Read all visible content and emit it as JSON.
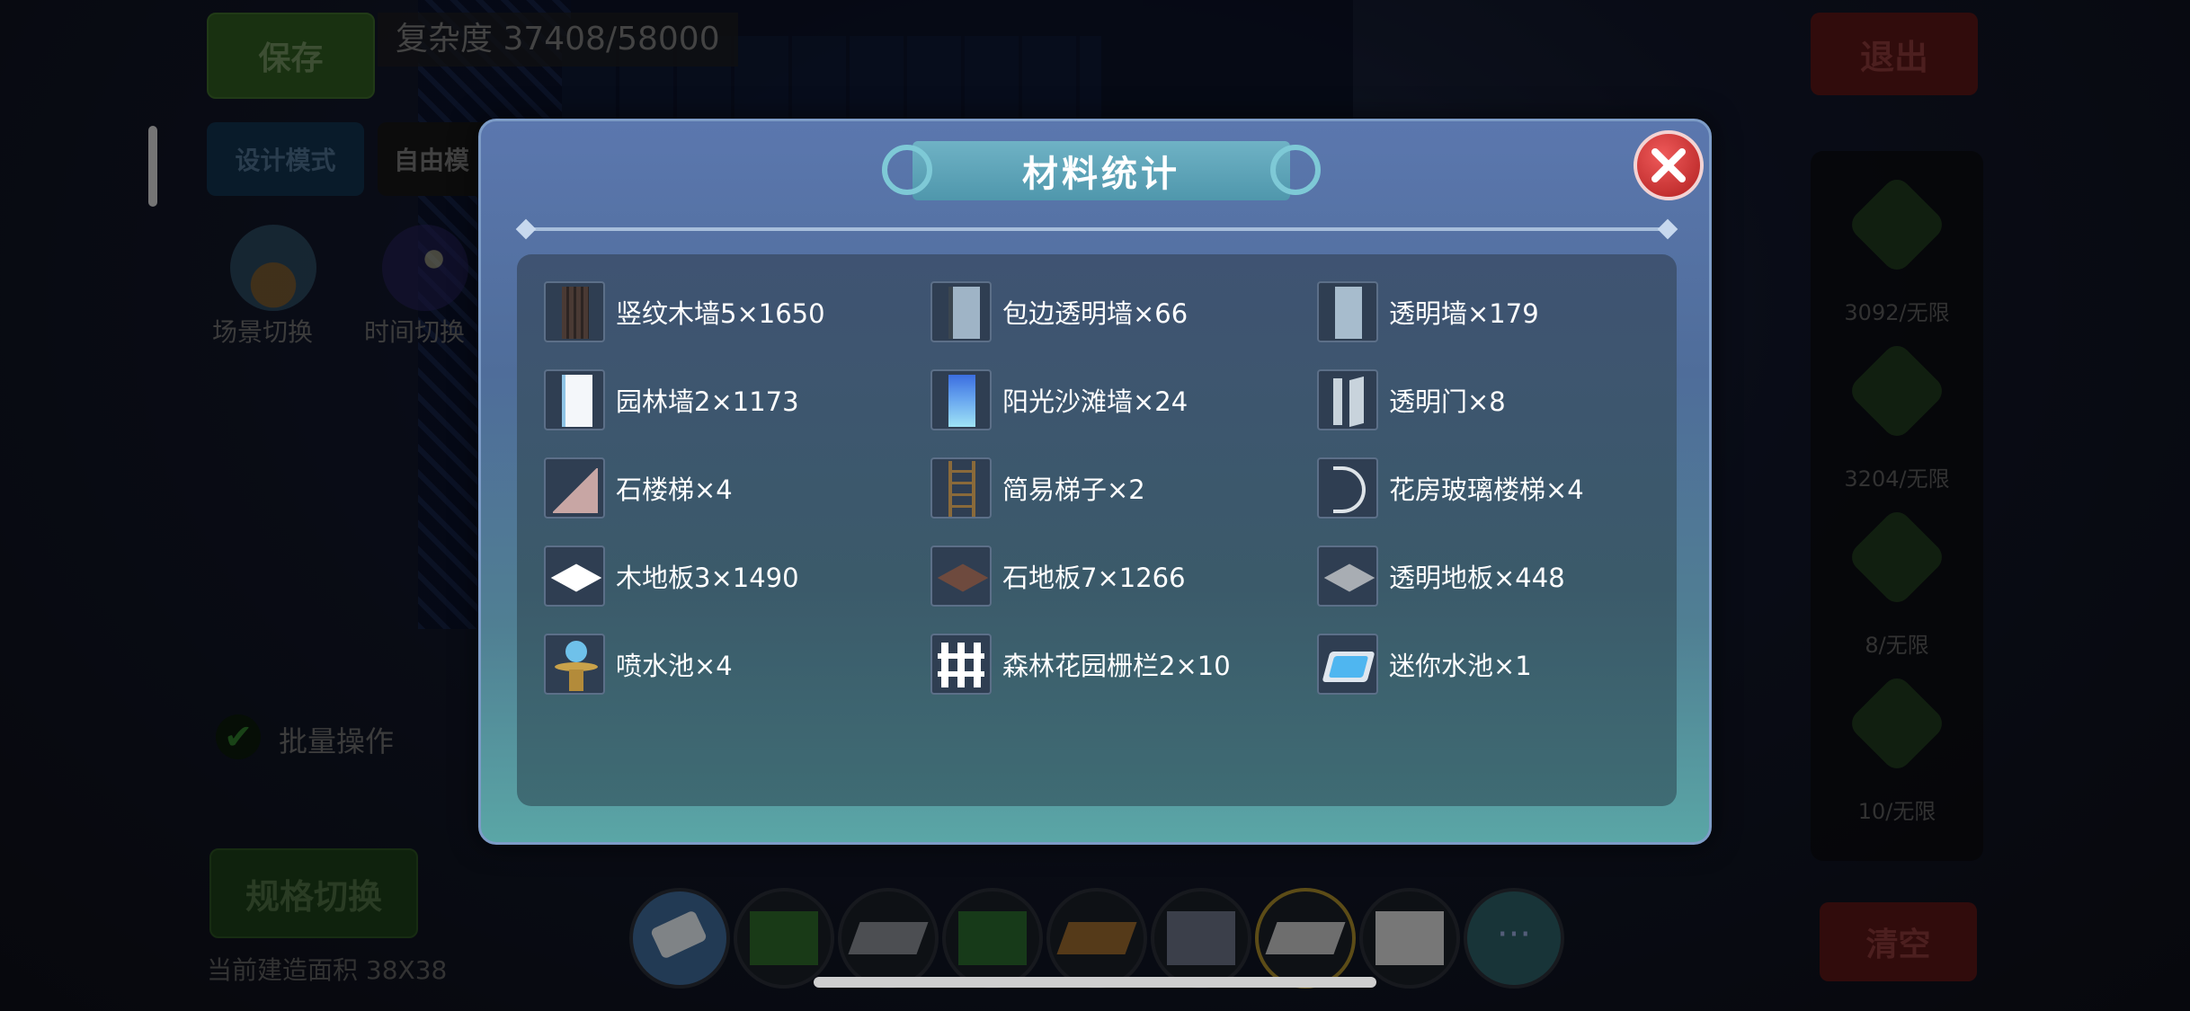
{
  "hud": {
    "save_label": "保存",
    "complexity_label": "复杂度 37408/58000",
    "design_mode_label": "设计模式",
    "free_mode_label": "自由模",
    "scene_switch_label": "场景切换",
    "time_switch_label": "时间切换",
    "batch_label": "批量操作",
    "spec_switch_label": "规格切换",
    "build_area_label": "当前建造面积 38X38",
    "exit_label": "退出",
    "clear_label": "清空",
    "more_label": "···"
  },
  "right_panel": [
    {
      "count": "3092/无限"
    },
    {
      "count": "3204/无限"
    },
    {
      "count": "8/无限"
    },
    {
      "count": "10/无限"
    }
  ],
  "dialog": {
    "title": "材料统计",
    "items": [
      {
        "name": "竖纹木墙5",
        "qty": "1650",
        "text": "竖纹木墙5×1650",
        "icon": "vertical-wood-wall-icon"
      },
      {
        "name": "包边透明墙",
        "qty": "66",
        "text": "包边透明墙×66",
        "icon": "bordered-glass-wall-icon"
      },
      {
        "name": "透明墙",
        "qty": "179",
        "text": "透明墙×179",
        "icon": "glass-wall-icon"
      },
      {
        "name": "园林墙2",
        "qty": "1173",
        "text": "园林墙2×1173",
        "icon": "garden-wall-icon"
      },
      {
        "name": "阳光沙滩墙",
        "qty": "24",
        "text": "阳光沙滩墙×24",
        "icon": "sunny-beach-wall-icon"
      },
      {
        "name": "透明门",
        "qty": "8",
        "text": "透明门×8",
        "icon": "glass-door-icon"
      },
      {
        "name": "石楼梯",
        "qty": "4",
        "text": "石楼梯×4",
        "icon": "stone-stairs-icon"
      },
      {
        "name": "简易梯子",
        "qty": "2",
        "text": "简易梯子×2",
        "icon": "simple-ladder-icon"
      },
      {
        "name": "花房玻璃楼梯",
        "qty": "4",
        "text": "花房玻璃楼梯×4",
        "icon": "glass-spiral-stairs-icon"
      },
      {
        "name": "木地板3",
        "qty": "1490",
        "text": "木地板3×1490",
        "icon": "wood-floor-icon"
      },
      {
        "name": "石地板7",
        "qty": "1266",
        "text": "石地板7×1266",
        "icon": "stone-floor-icon"
      },
      {
        "name": "透明地板",
        "qty": "448",
        "text": "透明地板×448",
        "icon": "glass-floor-icon"
      },
      {
        "name": "喷水池",
        "qty": "4",
        "text": "喷水池×4",
        "icon": "fountain-icon"
      },
      {
        "name": "森林花园栅栏2",
        "qty": "10",
        "text": "森林花园栅栏2×10",
        "icon": "garden-fence-icon"
      },
      {
        "name": "迷你水池",
        "qty": "1",
        "text": "迷你水池×1",
        "icon": "mini-pool-icon"
      }
    ]
  },
  "colors": {
    "dialog_top": "#5b77ae",
    "dialog_bottom": "#5aa6a6",
    "close_red": "#d23a3a",
    "save_green": "#2e5a1f",
    "exit_red": "#5a1616"
  }
}
